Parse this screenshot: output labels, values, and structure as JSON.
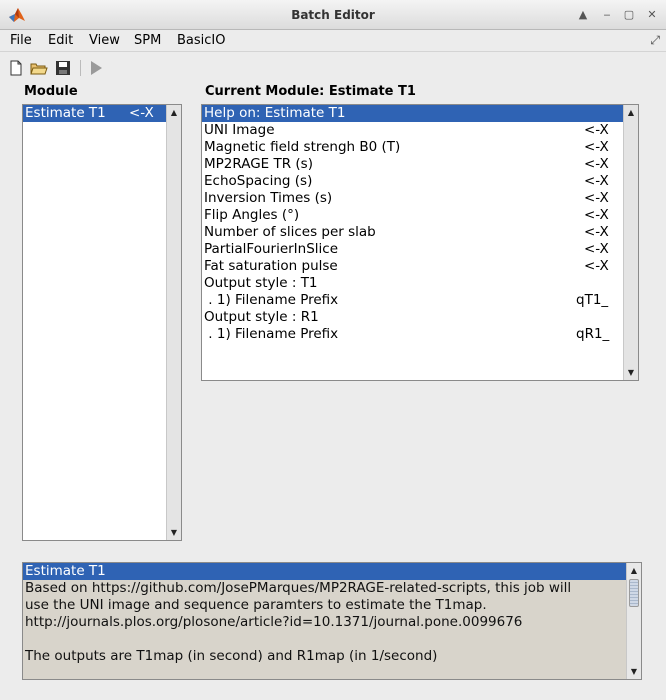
{
  "window": {
    "title": "Batch Editor"
  },
  "menu": [
    {
      "label": "File"
    },
    {
      "label": "Edit"
    },
    {
      "label": "View"
    },
    {
      "label": "SPM"
    },
    {
      "label": "BasicIO"
    }
  ],
  "toolbar": {
    "icons": [
      "new-file-icon",
      "open-folder-icon",
      "save-icon",
      "run-icon"
    ]
  },
  "module_panel": {
    "header": "Module",
    "items": [
      {
        "label": "Estimate T1",
        "flag": "<-X",
        "selected": true
      }
    ]
  },
  "current_module": {
    "header": "Current Module: Estimate T1",
    "items": [
      {
        "label": "Help on: Estimate T1",
        "value": "",
        "selected": true
      },
      {
        "label": "UNI Image",
        "value": "<-X"
      },
      {
        "label": "Magnetic field strengh B0 (T)",
        "value": "<-X"
      },
      {
        "label": "MP2RAGE TR (s)",
        "value": "<-X"
      },
      {
        "label": "EchoSpacing (s)",
        "value": "<-X"
      },
      {
        "label": "Inversion Times (s)",
        "value": "<-X"
      },
      {
        "label": "Flip Angles (°)",
        "value": "<-X"
      },
      {
        "label": "Number of slices per slab",
        "value": "<-X"
      },
      {
        "label": "PartialFourierInSlice",
        "value": "<-X"
      },
      {
        "label": "Fat saturation pulse",
        "value": "<-X"
      },
      {
        "label": "Output style : T1",
        "value": ""
      },
      {
        "label": " . 1) Filename Prefix",
        "value": "qT1_"
      },
      {
        "label": "Output style : R1",
        "value": ""
      },
      {
        "label": " . 1) Filename Prefix",
        "value": "qR1_"
      }
    ]
  },
  "help": {
    "title": "Estimate T1",
    "lines": [
      "Based on https://github.com/JosePMarques/MP2RAGE-related-scripts, this job will",
      "use the UNI image and sequence paramters to estimate the T1map.",
      "http://journals.plos.org/plosone/article?id=10.1371/journal.pone.0099676",
      "",
      "The outputs are T1map (in second) and R1map (in 1/second)"
    ]
  },
  "colors": {
    "selection": "#2f63b4",
    "help_background": "#d8d4cb",
    "window_background": "#ececec"
  }
}
